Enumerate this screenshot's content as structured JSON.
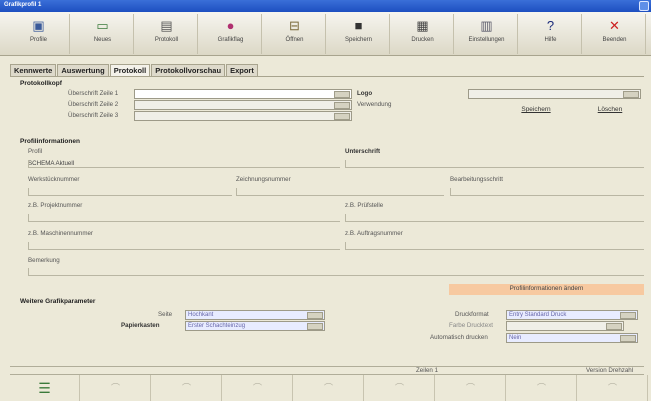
{
  "window": {
    "title": "Grafikprofil 1"
  },
  "toolbar": [
    {
      "icon": "profile-icon",
      "glyph": "▣",
      "color": "#3a5a9a",
      "label": "Profile"
    },
    {
      "icon": "new-icon",
      "glyph": "▭",
      "color": "#3b7a3b",
      "label": "Neues"
    },
    {
      "icon": "print-icon",
      "glyph": "▤",
      "color": "#555555",
      "label": "Protokoll"
    },
    {
      "icon": "fill-icon",
      "glyph": "●",
      "color": "#b03070",
      "label": "Grafikflag"
    },
    {
      "icon": "open-icon",
      "glyph": "⊟",
      "color": "#7a6a3a",
      "label": "Öffnen"
    },
    {
      "icon": "save-icon",
      "glyph": "■",
      "color": "#333333",
      "label": "Speichern"
    },
    {
      "icon": "print2-icon",
      "glyph": "▦",
      "color": "#444444",
      "label": "Drucken"
    },
    {
      "icon": "settings-icon",
      "glyph": "▥",
      "color": "#5a5a6a",
      "label": "Einstellungen"
    },
    {
      "icon": "help-icon",
      "glyph": "?",
      "color": "#1a2a7a",
      "label": "Hilfe"
    },
    {
      "icon": "close-icon",
      "glyph": "✕",
      "color": "#cc2020",
      "label": "Beenden"
    }
  ],
  "tabs": [
    "Kennwerte",
    "Auswertung",
    "Protokoll",
    "Protokollvorschau",
    "Export"
  ],
  "protocol_header": {
    "section": "Protokollkopf",
    "line1_label": "Überschrift Zeile 1",
    "line2_label": "Überschrift Zeile 2",
    "line3_label": "Überschrift Zeile 3",
    "logo_label": "Logo",
    "use_label": "Verwendung",
    "save_button": "Speichern",
    "delete_button": "Löschen"
  },
  "profile_info": {
    "section": "Profilinformationen",
    "profile_label": "Profil",
    "profile_value": "SCHEMA Aktuell",
    "subsection_label": "Unterschrift",
    "measure_label": "Werkstücknummer",
    "drawing_label": "Zeichnungsnummer",
    "editor_label": "Bearbeitungsschritt",
    "project_label": "z.B. Projektnummer",
    "test_label": "z.B. Prüfstelle",
    "machine_label": "z.B. Maschinennummer",
    "order_label": "z.B. Auftragsnummer",
    "remarks_label": "Bemerkung",
    "change_bar": "Profilinformationen ändern"
  },
  "other": {
    "section": "Weitere Grafikparameter",
    "page_label": "Seite",
    "page_value": "Hochkant",
    "unit_label": "Papierkasten",
    "unit_value": "Erster Schachteinzug",
    "printer_label": "Druckformat",
    "printer_value": "Entry Standard Druck",
    "format_label": "Farbe Drucktext",
    "auto_label": "Automatisch drucken",
    "auto_value": "Nein"
  },
  "status": {
    "left": "",
    "middle": "Zeilen 1",
    "right": "Version Drehzahl"
  }
}
